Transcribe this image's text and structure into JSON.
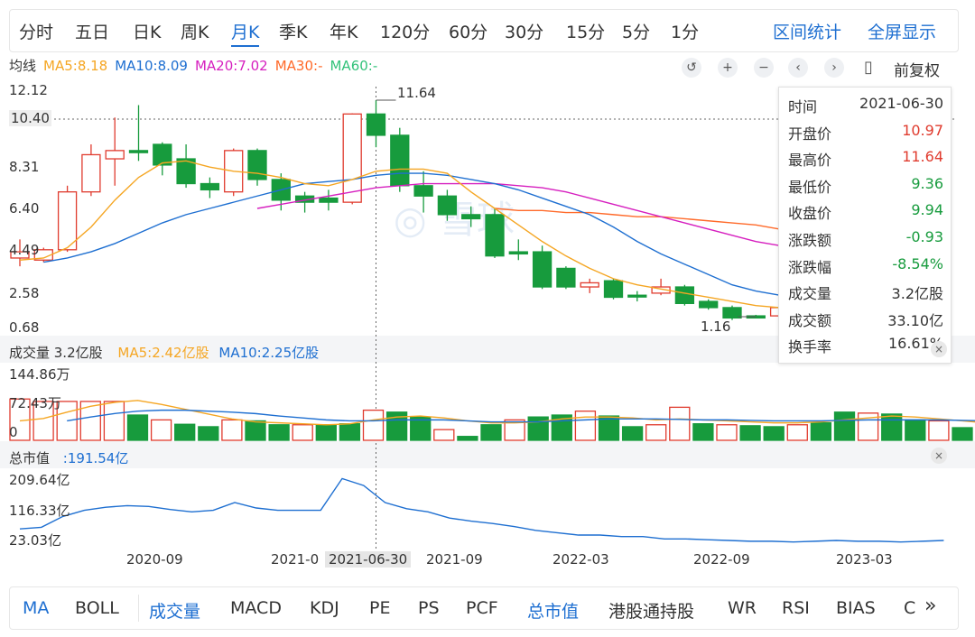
{
  "period_tabs": [
    "分时",
    "五日",
    "日K",
    "周K",
    "月K",
    "季K",
    "年K",
    "120分",
    "60分",
    "30分",
    "15分",
    "5分",
    "1分"
  ],
  "active_period": "月K",
  "right_links": [
    "区间统计",
    "全屏显示"
  ],
  "ma_legend": {
    "title": "均线",
    "items": [
      {
        "text": "MA5:8.18",
        "color": "#f5a623"
      },
      {
        "text": "MA10:8.09",
        "color": "#1e6fd1"
      },
      {
        "text": "MA20:7.02",
        "color": "#d61fbf"
      },
      {
        "text": "MA30:-",
        "color": "#ff6a2a"
      },
      {
        "text": "MA60:-",
        "color": "#33c27a"
      }
    ]
  },
  "fuquan_label": "前复权",
  "toolbar_icons": [
    "undo-icon",
    "zoom-in-icon",
    "zoom-out-icon",
    "left-icon",
    "right-icon",
    "candle-icon"
  ],
  "price_axis": [
    "12.12",
    "10.40",
    "8.31",
    "6.40",
    "4.49",
    "2.58",
    "0.68"
  ],
  "annotations": {
    "high_label": "11.64",
    "low_label": "1.16",
    "crosshair_date": "2021-06-30"
  },
  "date_axis": [
    "2020-09",
    "2021-0",
    "2021-09",
    "2022-03",
    "2022-09",
    "2023-03"
  ],
  "volume_panel": {
    "title": "成交量 3.2亿股",
    "ma5": "MA5:2.42亿股",
    "ma10": "MA10:2.25亿股",
    "axis": [
      "144.86万",
      "72.43万",
      "0"
    ]
  },
  "market_cap_panel": {
    "title": "总市值",
    "value": ":191.54亿",
    "axis": [
      "209.64亿",
      "116.33亿",
      "23.03亿"
    ]
  },
  "info_box": [
    {
      "k": "时间",
      "v": "2021-06-30",
      "c": "#333"
    },
    {
      "k": "开盘价",
      "v": "10.97",
      "c": "#e03b2e"
    },
    {
      "k": "最高价",
      "v": "11.64",
      "c": "#e03b2e"
    },
    {
      "k": "最低价",
      "v": "9.36",
      "c": "#179b3d"
    },
    {
      "k": "收盘价",
      "v": "9.94",
      "c": "#179b3d"
    },
    {
      "k": "涨跌额",
      "v": "-0.93",
      "c": "#179b3d"
    },
    {
      "k": "涨跌幅",
      "v": "-8.54%",
      "c": "#179b3d"
    },
    {
      "k": "成交量",
      "v": "3.2亿股",
      "c": "#333"
    },
    {
      "k": "成交额",
      "v": "33.10亿",
      "c": "#333"
    },
    {
      "k": "换手率",
      "v": "16.61%",
      "c": "#333"
    }
  ],
  "indicator_tabs": [
    "MA",
    "BOLL",
    "成交量",
    "MACD",
    "KDJ",
    "PE",
    "PS",
    "PCF",
    "总市值",
    "港股通持股",
    "WR",
    "RSI",
    "BIAS",
    "C"
  ],
  "more_label": "»",
  "colors": {
    "up": "#e03b2e",
    "down": "#179b3d",
    "ma5": "#f5a623",
    "ma10": "#1e6fd1",
    "ma20": "#d61fbf",
    "ma30": "#ff6a2a",
    "cap": "#1e6fd1"
  },
  "chart_data": {
    "type": "candlestick",
    "ylim": [
      0.68,
      12.12
    ],
    "candles": [
      {
        "o": 4.0,
        "c": 4.3,
        "h": 4.9,
        "l": 3.6
      },
      {
        "o": 3.9,
        "c": 4.4,
        "h": 4.5,
        "l": 3.8
      },
      {
        "o": 4.4,
        "c": 7.2,
        "h": 7.5,
        "l": 4.3
      },
      {
        "o": 7.2,
        "c": 9.0,
        "h": 9.5,
        "l": 7.0
      },
      {
        "o": 8.8,
        "c": 9.2,
        "h": 10.8,
        "l": 7.5
      },
      {
        "o": 9.2,
        "c": 9.1,
        "h": 11.4,
        "l": 8.7
      },
      {
        "o": 9.5,
        "c": 8.5,
        "h": 9.6,
        "l": 8.0
      },
      {
        "o": 8.8,
        "c": 7.6,
        "h": 9.5,
        "l": 7.4
      },
      {
        "o": 7.6,
        "c": 7.3,
        "h": 7.9,
        "l": 6.9
      },
      {
        "o": 7.2,
        "c": 9.2,
        "h": 9.3,
        "l": 7.0
      },
      {
        "o": 9.2,
        "c": 7.8,
        "h": 9.3,
        "l": 7.5
      },
      {
        "o": 7.8,
        "c": 6.8,
        "h": 8.1,
        "l": 6.3
      },
      {
        "o": 7.0,
        "c": 6.7,
        "h": 7.2,
        "l": 6.2
      },
      {
        "o": 6.9,
        "c": 6.7,
        "h": 7.3,
        "l": 6.3
      },
      {
        "o": 6.7,
        "c": 10.97,
        "h": 11.0,
        "l": 6.6
      },
      {
        "o": 10.97,
        "c": 9.94,
        "h": 11.64,
        "l": 9.36
      },
      {
        "o": 9.94,
        "c": 7.5,
        "h": 10.3,
        "l": 7.2
      },
      {
        "o": 7.5,
        "c": 7.0,
        "h": 8.2,
        "l": 6.2
      },
      {
        "o": 7.0,
        "c": 6.1,
        "h": 7.3,
        "l": 5.8
      },
      {
        "o": 6.1,
        "c": 5.9,
        "h": 6.5,
        "l": 5.5
      },
      {
        "o": 6.1,
        "c": 4.1,
        "h": 6.4,
        "l": 4.0
      },
      {
        "o": 4.3,
        "c": 4.2,
        "h": 4.9,
        "l": 3.9
      },
      {
        "o": 4.3,
        "c": 2.6,
        "h": 4.6,
        "l": 2.5
      },
      {
        "o": 3.5,
        "c": 2.6,
        "h": 3.6,
        "l": 2.5
      },
      {
        "o": 2.6,
        "c": 2.8,
        "h": 3.0,
        "l": 2.3
      },
      {
        "o": 2.9,
        "c": 2.1,
        "h": 3.0,
        "l": 2.0
      },
      {
        "o": 2.2,
        "c": 2.15,
        "h": 2.4,
        "l": 1.9
      },
      {
        "o": 2.3,
        "c": 2.6,
        "h": 3.0,
        "l": 2.2
      },
      {
        "o": 2.6,
        "c": 1.8,
        "h": 2.7,
        "l": 1.7
      },
      {
        "o": 1.9,
        "c": 1.6,
        "h": 2.0,
        "l": 1.5
      },
      {
        "o": 1.6,
        "c": 1.1,
        "h": 1.7,
        "l": 1.0
      },
      {
        "o": 1.2,
        "c": 1.1,
        "h": 1.25,
        "l": 1.16
      },
      {
        "o": 1.2,
        "c": 1.6,
        "h": 1.7,
        "l": 1.16
      }
    ],
    "ma5": [
      3.9,
      4.0,
      4.5,
      5.5,
      6.8,
      7.9,
      8.6,
      8.7,
      8.4,
      8.2,
      8.1,
      7.9,
      7.6,
      7.5,
      7.8,
      8.2,
      8.3,
      8.3,
      8.1,
      7.2,
      6.4,
      5.6,
      4.8,
      4.1,
      3.5,
      3.0,
      2.7,
      2.5,
      2.3,
      2.1,
      1.9,
      1.7,
      1.6
    ],
    "ma10": [
      null,
      3.8,
      4.0,
      4.3,
      4.7,
      5.2,
      5.7,
      6.1,
      6.4,
      6.7,
      7.0,
      7.3,
      7.6,
      7.7,
      7.8,
      8.0,
      8.1,
      8.1,
      8.0,
      7.8,
      7.6,
      7.3,
      6.9,
      6.5,
      6.1,
      5.5,
      4.8,
      4.2,
      3.7,
      3.2,
      2.7,
      2.4,
      2.2
    ],
    "ma20": [
      null,
      null,
      null,
      null,
      null,
      null,
      null,
      null,
      null,
      null,
      6.4,
      6.6,
      6.8,
      7.0,
      7.2,
      7.4,
      7.5,
      7.6,
      7.6,
      7.6,
      7.6,
      7.5,
      7.4,
      7.2,
      6.9,
      6.6,
      6.3,
      6.0,
      5.7,
      5.4,
      5.1,
      4.8,
      4.6
    ],
    "ma30": [
      null,
      null,
      null,
      null,
      null,
      null,
      null,
      null,
      null,
      null,
      null,
      null,
      null,
      null,
      null,
      null,
      null,
      null,
      null,
      null,
      6.4,
      6.3,
      6.3,
      6.2,
      6.2,
      6.1,
      6.0,
      6.0,
      5.9,
      5.8,
      5.7,
      5.6,
      5.4
    ],
    "volume": [
      85,
      80,
      80,
      80,
      80,
      52,
      42,
      33,
      28,
      42,
      40,
      32,
      32,
      32,
      34,
      62,
      58,
      48,
      22,
      8,
      32,
      42,
      48,
      52,
      60,
      50,
      28,
      32,
      68,
      34,
      32,
      30,
      28,
      32,
      36,
      58,
      56,
      54,
      42,
      40,
      26,
      22,
      32
    ],
    "volume_ylim": [
      0,
      144.86
    ],
    "vol_ma5": [
      40,
      45,
      58,
      70,
      78,
      82,
      74,
      64,
      54,
      44,
      38,
      36,
      34,
      32,
      34,
      42,
      48,
      50,
      46,
      40,
      36,
      36,
      38,
      44,
      48,
      48,
      46,
      42,
      44,
      42,
      40,
      38,
      36,
      36,
      38,
      42,
      46,
      50,
      48,
      44,
      40,
      36,
      34
    ],
    "vol_ma10": [
      null,
      null,
      40,
      48,
      55,
      60,
      62,
      62,
      60,
      58,
      55,
      50,
      46,
      42,
      40,
      40,
      42,
      42,
      42,
      40,
      38,
      38,
      38,
      40,
      42,
      44,
      44,
      44,
      43,
      42,
      42,
      41,
      40,
      40,
      40,
      41,
      42,
      42,
      42,
      42,
      41,
      40,
      40
    ],
    "market_cap": [
      60,
      64,
      92,
      108,
      116,
      120,
      118,
      110,
      104,
      108,
      128,
      114,
      108,
      108,
      108,
      190,
      172,
      128,
      112,
      104,
      88,
      80,
      74,
      66,
      56,
      50,
      44,
      44,
      40,
      40,
      34,
      34,
      32,
      30,
      28,
      28,
      26,
      28,
      30,
      28,
      28,
      26,
      28,
      30
    ],
    "market_cap_ylim": [
      23.03,
      209.64
    ]
  }
}
